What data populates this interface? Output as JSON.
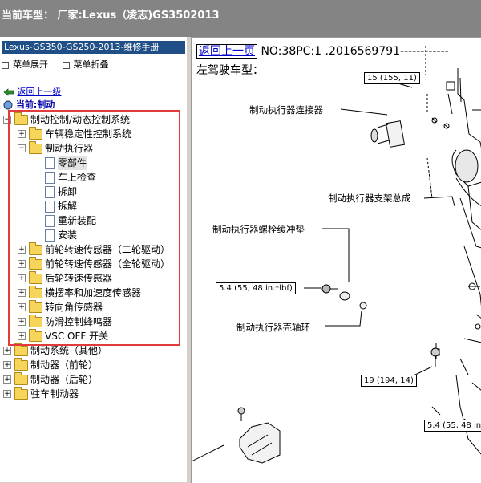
{
  "window": {
    "title": "当前车型： 厂家:Lexus（凌志)GS3502013"
  },
  "sidebar": {
    "manual_title": "Lexus-GS350-GS250-2013-维修手册",
    "menu": [
      "菜单展开",
      "菜单折叠"
    ],
    "back_link": "返回上一级",
    "current": "当前:制动",
    "tree": {
      "root": "制动控制/动态控制系统",
      "child_vsc": "车辆稳定性控制系统",
      "child_actuator": "制动执行器",
      "pages": [
        "零部件",
        "车上检查",
        "拆卸",
        "拆解",
        "重新装配",
        "安装"
      ],
      "others": [
        "前轮转速传感器（二轮驱动）",
        "前轮转速传感器（全轮驱动）",
        "后轮转速传感器",
        "横摆率和加速度传感器",
        "转向角传感器",
        "防滑控制蜂鸣器",
        "VSC OFF 开关"
      ],
      "top_others": [
        "制动系统（其他）",
        "制动器（前轮）",
        "制动器（后轮）",
        "驻车制动器"
      ]
    }
  },
  "content": {
    "back_label": "返回上一页",
    "doc_id": "NO:38PC:1 .2016569791------------",
    "heading": "左驾驶车型：",
    "callouts": {
      "connector": "制动执行器连接器",
      "bracket": "制动执行器支架总成",
      "cushion": "制动执行器螺栓缓冲垫",
      "collar": "制动执行器壳轴环"
    },
    "torque": {
      "t1": "15 (155, 11)",
      "t2": "5.4 (55, 48 in.*lbf)",
      "t3": "19 (194, 14)",
      "t4": "5.4 (55, 48 in.*"
    }
  },
  "colors": {
    "highlight_box": "#e23b3b",
    "title_bar": "#1f4f86",
    "window_bar": "#848484"
  }
}
